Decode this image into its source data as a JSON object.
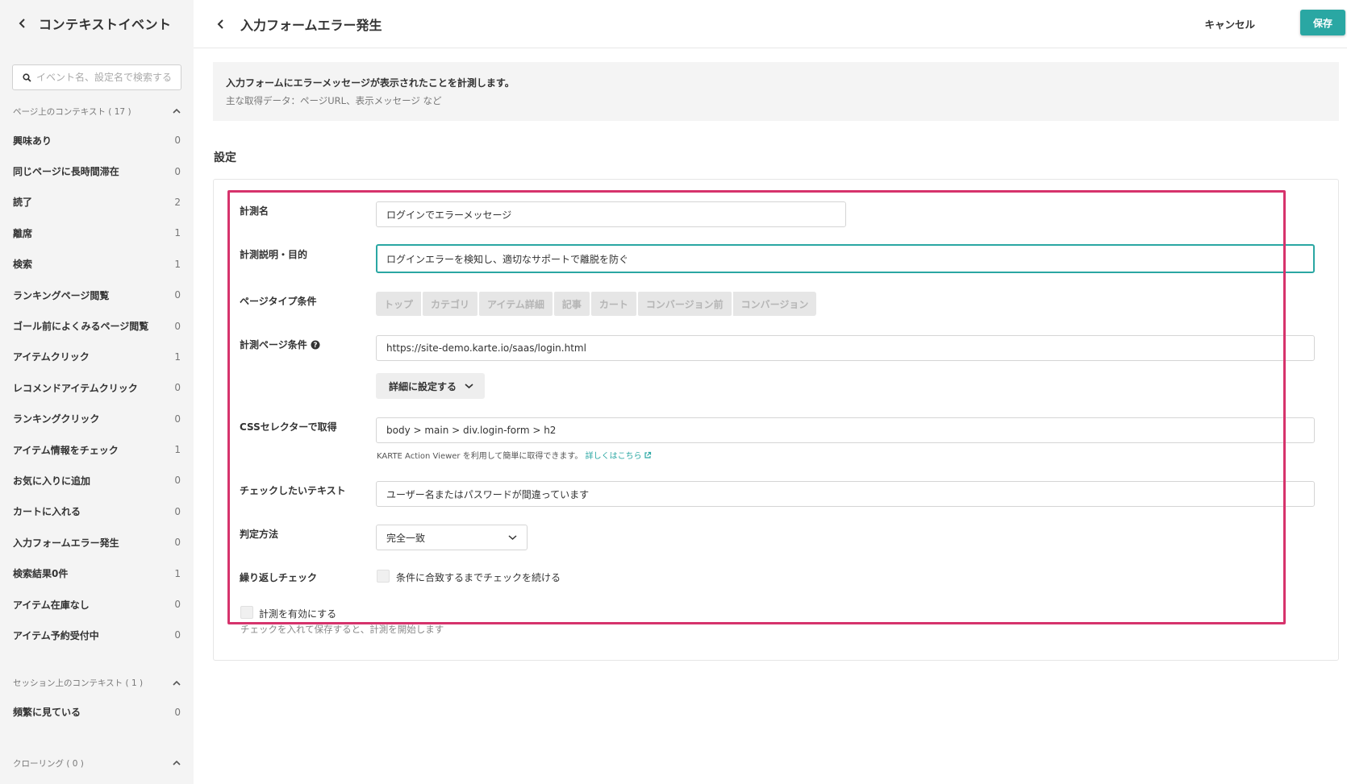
{
  "sidebar": {
    "title": "コンテキストイベント",
    "search_placeholder": "イベント名、設定名で検索する",
    "section_page": "ページ上のコンテキスト ( 17 )",
    "items_page": [
      {
        "label": "興味あり",
        "count": "0"
      },
      {
        "label": "同じページに長時間滞在",
        "count": "0"
      },
      {
        "label": "読了",
        "count": "2"
      },
      {
        "label": "離席",
        "count": "1"
      },
      {
        "label": "検索",
        "count": "1"
      },
      {
        "label": "ランキングページ閲覧",
        "count": "0"
      },
      {
        "label": "ゴール前によくみるページ閲覧",
        "count": "0"
      },
      {
        "label": "アイテムクリック",
        "count": "1"
      },
      {
        "label": "レコメンドアイテムクリック",
        "count": "0"
      },
      {
        "label": "ランキングクリック",
        "count": "0"
      },
      {
        "label": "アイテム情報をチェック",
        "count": "1"
      },
      {
        "label": "お気に入りに追加",
        "count": "0"
      },
      {
        "label": "カートに入れる",
        "count": "0"
      },
      {
        "label": "入力フォームエラー発生",
        "count": "0"
      },
      {
        "label": "検索結果0件",
        "count": "1"
      },
      {
        "label": "アイテム在庫なし",
        "count": "0"
      },
      {
        "label": "アイテム予約受付中",
        "count": "0"
      }
    ],
    "section_session": "セッション上のコンテキスト ( 1 )",
    "items_session": [
      {
        "label": "頻繁に見ている",
        "count": "0"
      }
    ],
    "section_crawling": "クローリング ( 0 )"
  },
  "header": {
    "title": "入力フォームエラー発生",
    "cancel_label": "キャンセル",
    "save_label": "保存"
  },
  "description": {
    "main": "入力フォームにエラーメッセージが表示されたことを計測します。",
    "sub": "主な取得データ：ページURL、表示メッセージ など"
  },
  "settings": {
    "section_title": "設定",
    "name_label": "計測名",
    "name_value": "ログインでエラーメッセージ",
    "purpose_label": "計測説明・目的",
    "purpose_value": "ログインエラーを検知し、適切なサポートで離脱を防ぐ",
    "page_type_label": "ページタイプ条件",
    "page_types": [
      "トップ",
      "カテゴリ",
      "アイテム詳細",
      "記事",
      "カート",
      "コンバージョン前",
      "コンバージョン"
    ],
    "page_condition_label": "計測ページ条件",
    "page_condition_value": "https://site-demo.karte.io/saas/login.html",
    "detail_button": "詳細に設定する",
    "css_label": "CSSセレクターで取得",
    "css_value": "body > main > div.login-form > h2",
    "css_hint": "KARTE Action Viewer を利用して簡単に取得できます。",
    "css_hint_link": "詳しくはこちら",
    "check_text_label": "チェックしたいテキスト",
    "check_text_value": "ユーザー名またはパスワードが間違っています",
    "judge_label": "判定方法",
    "judge_value": "完全一致",
    "repeat_label": "繰り返しチェック",
    "repeat_checkbox_label": "条件に合致するまでチェックを続ける",
    "enable_label": "計測を有効にする",
    "enable_hint": "チェックを入れて保存すると、計測を開始します"
  },
  "colors": {
    "accent": "#2aa7a3",
    "highlight": "#d6336c"
  }
}
